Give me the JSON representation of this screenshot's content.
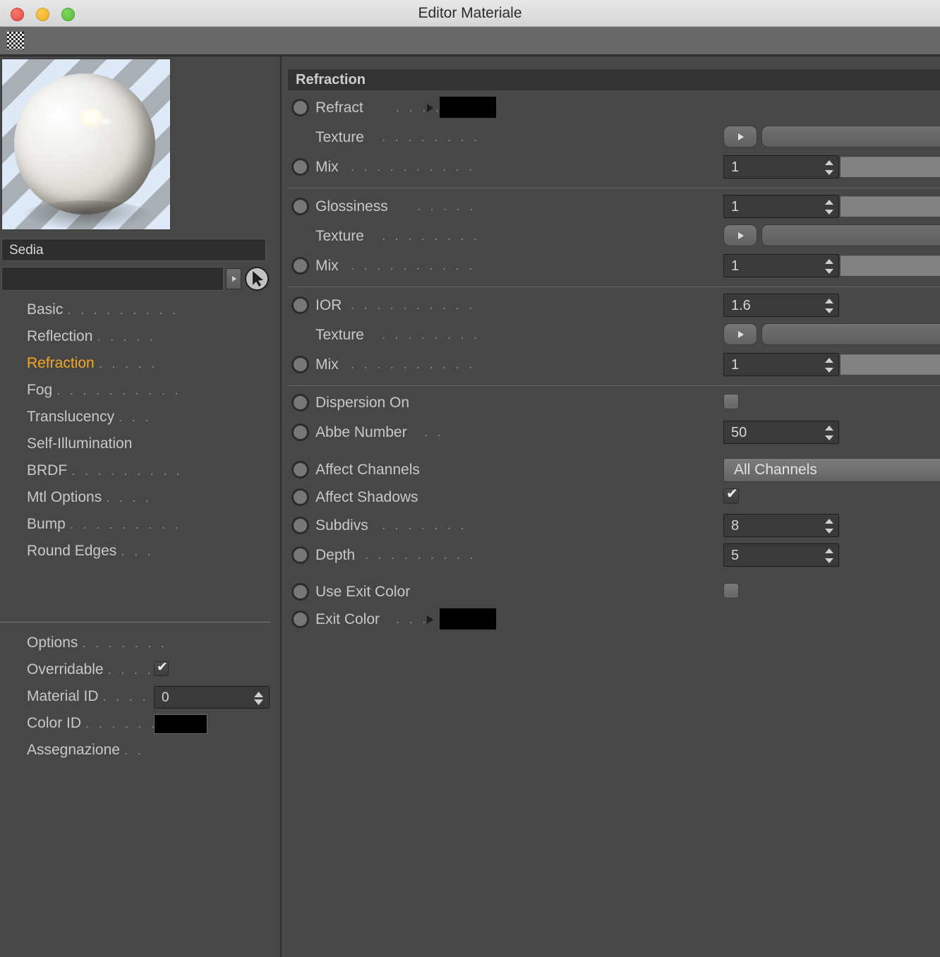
{
  "window": {
    "title": "Editor Materiale",
    "traffic_lights": [
      "close",
      "minimize",
      "maximize"
    ]
  },
  "toolbar": {
    "checker_icon": "checkerboard-icon",
    "back_icon": "nav-back-arrow-icon",
    "forward_icon": "nav-forward-arrow-icon",
    "up_icon": "nav-up-arrow-icon",
    "lock_icon": "lock-open-icon",
    "plus_icon": "add-plus-icon"
  },
  "sidebar": {
    "preview_label": "material-preview-sphere",
    "material_name": "Sedia",
    "search_value": "",
    "search_arrow_icon": "expand-arrow-icon",
    "cursor_icon": "pointer-cursor-icon",
    "channels": [
      {
        "label": "Basic",
        "dots": ". . . . . . . . .",
        "active": false
      },
      {
        "label": "Reflection",
        "dots": ". . . . .",
        "active": false
      },
      {
        "label": "Refraction",
        "dots": ". . . . .",
        "active": true
      },
      {
        "label": "Fog",
        "dots": ". . . . . . . . . .",
        "active": false
      },
      {
        "label": "Translucency",
        "dots": ". . .",
        "active": false
      },
      {
        "label": "Self-Illumination",
        "dots": "",
        "active": false
      },
      {
        "label": "BRDF",
        "dots": ". . . . . . . . .",
        "active": false
      },
      {
        "label": "Mtl Options",
        "dots": ". . . .",
        "active": false
      },
      {
        "label": "Bump",
        "dots": ". . . . . . . . .",
        "active": false
      },
      {
        "label": "Round Edges",
        "dots": ". . .",
        "active": false
      }
    ],
    "options": [
      {
        "label": "Options",
        "dots": ". . . . . . ."
      },
      {
        "label": "Overridable",
        "dots": ". . . ."
      },
      {
        "label": "Material ID",
        "dots": ". . . . ."
      },
      {
        "label": "Color ID",
        "dots": ". . . . . . ."
      },
      {
        "label": "Assegnazione",
        "dots": ". ."
      }
    ],
    "overridable_checked": true,
    "material_id_value": "0",
    "color_id_value": "#000000"
  },
  "panel": {
    "section_title": "Refraction",
    "rows": [
      {
        "name": "refract",
        "label": "Refract",
        "dots": ". . . . .",
        "type": "color",
        "value": "#000000"
      },
      {
        "name": "refract-texture",
        "label": "Texture",
        "dots": ". . . . . . . .",
        "type": "texture",
        "value": "",
        "more_label": "..."
      },
      {
        "name": "refract-mix",
        "label": "Mix",
        "dots": ". . . . . . . . . .",
        "type": "slider",
        "value": "1"
      },
      {
        "name": "glossiness",
        "label": "Glossiness",
        "dots": ". . . . .",
        "type": "slider",
        "value": "1"
      },
      {
        "name": "gloss-texture",
        "label": "Texture",
        "dots": ". . . . . . . .",
        "type": "texture",
        "value": "",
        "more_label": "..."
      },
      {
        "name": "gloss-mix",
        "label": "Mix",
        "dots": ". . . . . . . . . .",
        "type": "slider",
        "value": "1"
      },
      {
        "name": "ior",
        "label": "IOR",
        "dots": ". . . . . . . . . .",
        "type": "number",
        "value": "1.6"
      },
      {
        "name": "ior-texture",
        "label": "Texture",
        "dots": ". . . . . . . .",
        "type": "texture",
        "value": "",
        "more_label": "..."
      },
      {
        "name": "ior-mix",
        "label": "Mix",
        "dots": ". . . . . . . . . .",
        "type": "slider",
        "value": "1"
      },
      {
        "name": "dispersion-on",
        "label": "Dispersion On",
        "dots": "",
        "type": "checkbox",
        "checked": false
      },
      {
        "name": "abbe-number",
        "label": "Abbe Number",
        "dots": ". .",
        "type": "number",
        "value": "50"
      },
      {
        "name": "affect-channels",
        "label": "Affect Channels",
        "dots": "",
        "type": "dropdown",
        "value": "All Channels"
      },
      {
        "name": "affect-shadows",
        "label": "Affect Shadows",
        "dots": "",
        "type": "checkbox",
        "checked": true
      },
      {
        "name": "subdivs",
        "label": "Subdivs",
        "dots": ". . . . . . .",
        "type": "number",
        "value": "8"
      },
      {
        "name": "depth",
        "label": "Depth",
        "dots": ". . . . . . . . .",
        "type": "number",
        "value": "5"
      },
      {
        "name": "use-exit-color",
        "label": "Use Exit Color",
        "dots": "",
        "type": "checkbox",
        "checked": false
      },
      {
        "name": "exit-color",
        "label": "Exit Color",
        "dots": ". . .",
        "type": "color",
        "value": "#000000"
      }
    ]
  },
  "colors": {
    "accent": "#f5a623",
    "panel_bg": "#474747",
    "toolbar_bg": "#686868",
    "header_bg": "#333333",
    "text": "#c8c8c8"
  }
}
